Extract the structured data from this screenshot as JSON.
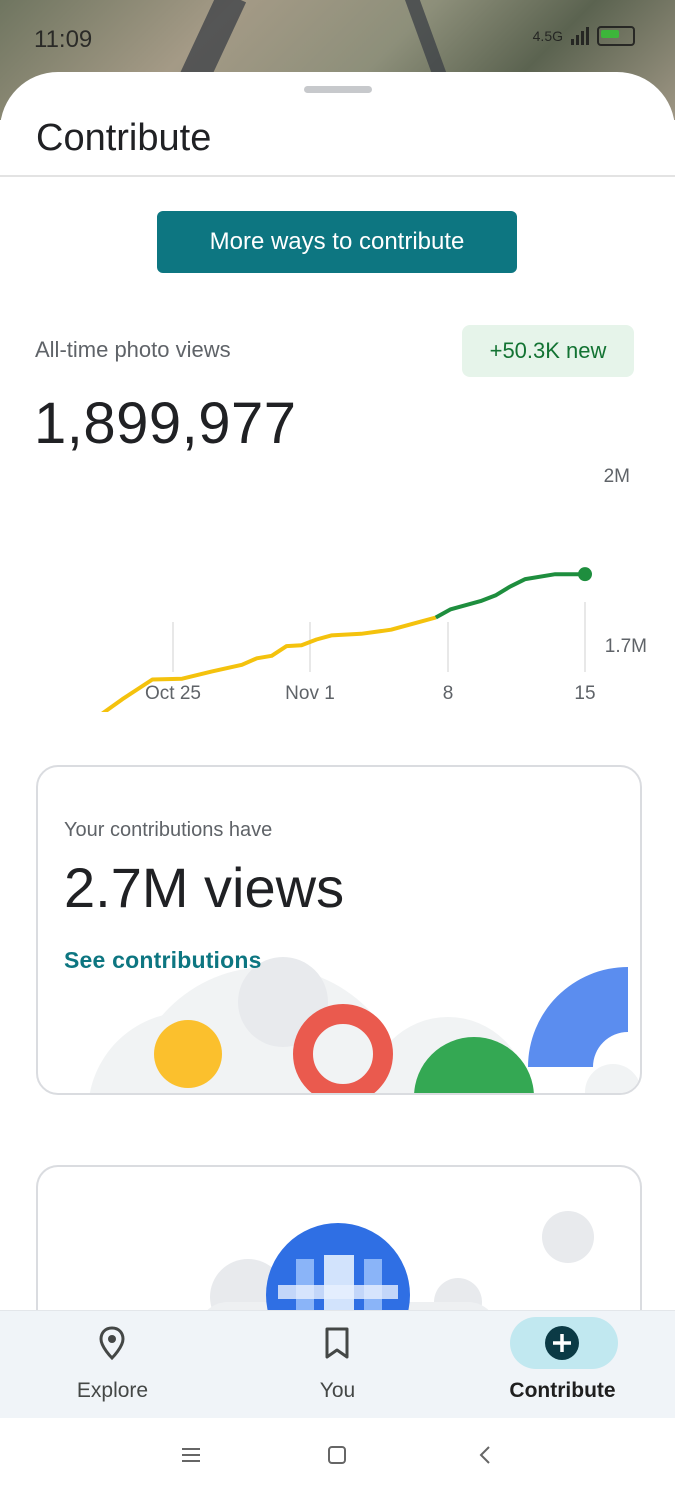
{
  "status_bar": {
    "time": "11:09",
    "network": "4.5G",
    "battery_icon": "battery-icon"
  },
  "sheet": {
    "title": "Contribute"
  },
  "cta": {
    "label": "More ways to contribute"
  },
  "photo_views": {
    "label": "All-time photo views",
    "total": "1,899,977",
    "new_badge": "+50.3K new"
  },
  "chart_data": {
    "type": "line",
    "title": "",
    "xlabel": "",
    "ylabel": "",
    "x_ticks": [
      "Oct 25",
      "Nov 1",
      "8",
      "15"
    ],
    "y_ticks": [
      "2M",
      "1.7M"
    ],
    "ylim": [
      1700000,
      2000000
    ],
    "series": [
      {
        "name": "",
        "color": "#f4c20d",
        "x": [
          0,
          2,
          4,
          6,
          8,
          10,
          12,
          14,
          15,
          16,
          17,
          18,
          19,
          20,
          22,
          24,
          26,
          27
        ],
        "values": [
          1700000,
          1702000,
          1702000,
          1728000,
          1752000,
          1753000,
          1762000,
          1770000,
          1778000,
          1781000,
          1793000,
          1794000,
          1801000,
          1806000,
          1808000,
          1813000,
          1823000,
          1828000
        ]
      },
      {
        "name": "",
        "color": "#1e8e3e",
        "x": [
          27,
          28,
          30,
          31,
          32,
          33,
          35,
          36,
          37
        ],
        "values": [
          1828000,
          1838000,
          1848000,
          1855000,
          1866000,
          1875000,
          1881000,
          1881000,
          1881000
        ]
      }
    ],
    "grid": false
  },
  "contributions_card": {
    "caption": "Your contributions have",
    "value": "2.7M views",
    "link": "See contributions"
  },
  "bottom_nav": {
    "items": [
      {
        "label": "Explore",
        "icon": "location-pin-icon"
      },
      {
        "label": "You",
        "icon": "bookmark-icon"
      },
      {
        "label": "Contribute",
        "icon": "add-circle-icon"
      }
    ]
  },
  "system_nav": {
    "recents": "recents-icon",
    "home": "home-icon",
    "back": "back-icon"
  }
}
